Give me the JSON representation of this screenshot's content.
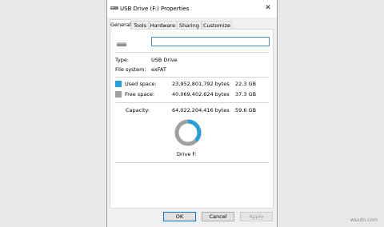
{
  "window": {
    "title": "USB Drive (F:) Properties",
    "close_glyph": "✕"
  },
  "tabs": [
    {
      "label": "General",
      "active": true
    },
    {
      "label": "Tools",
      "active": false
    },
    {
      "label": "Hardware",
      "active": false
    },
    {
      "label": "Sharing",
      "active": false
    },
    {
      "label": "Customize",
      "active": false
    }
  ],
  "general": {
    "name_value": "",
    "type_label": "Type:",
    "type_value": "USB Drive",
    "fs_label": "File system:",
    "fs_value": "exFAT",
    "used_label": "Used space:",
    "used_bytes": "23,952,801,792 bytes",
    "used_size": "22.3 GB",
    "free_label": "Free space:",
    "free_bytes": "40,069,402,624 bytes",
    "free_size": "37.3 GB",
    "capacity_label": "Capacity:",
    "capacity_bytes": "64,022,204,416 bytes",
    "capacity_size": "59.6 GB",
    "drive_label": "Drive F:",
    "used_fraction": 0.374
  },
  "colors": {
    "used": "#26a0da",
    "free": "#a0a0a0"
  },
  "buttons": {
    "ok": "OK",
    "cancel": "Cancel",
    "apply": "Apply"
  },
  "watermark": "wsxdn.com"
}
